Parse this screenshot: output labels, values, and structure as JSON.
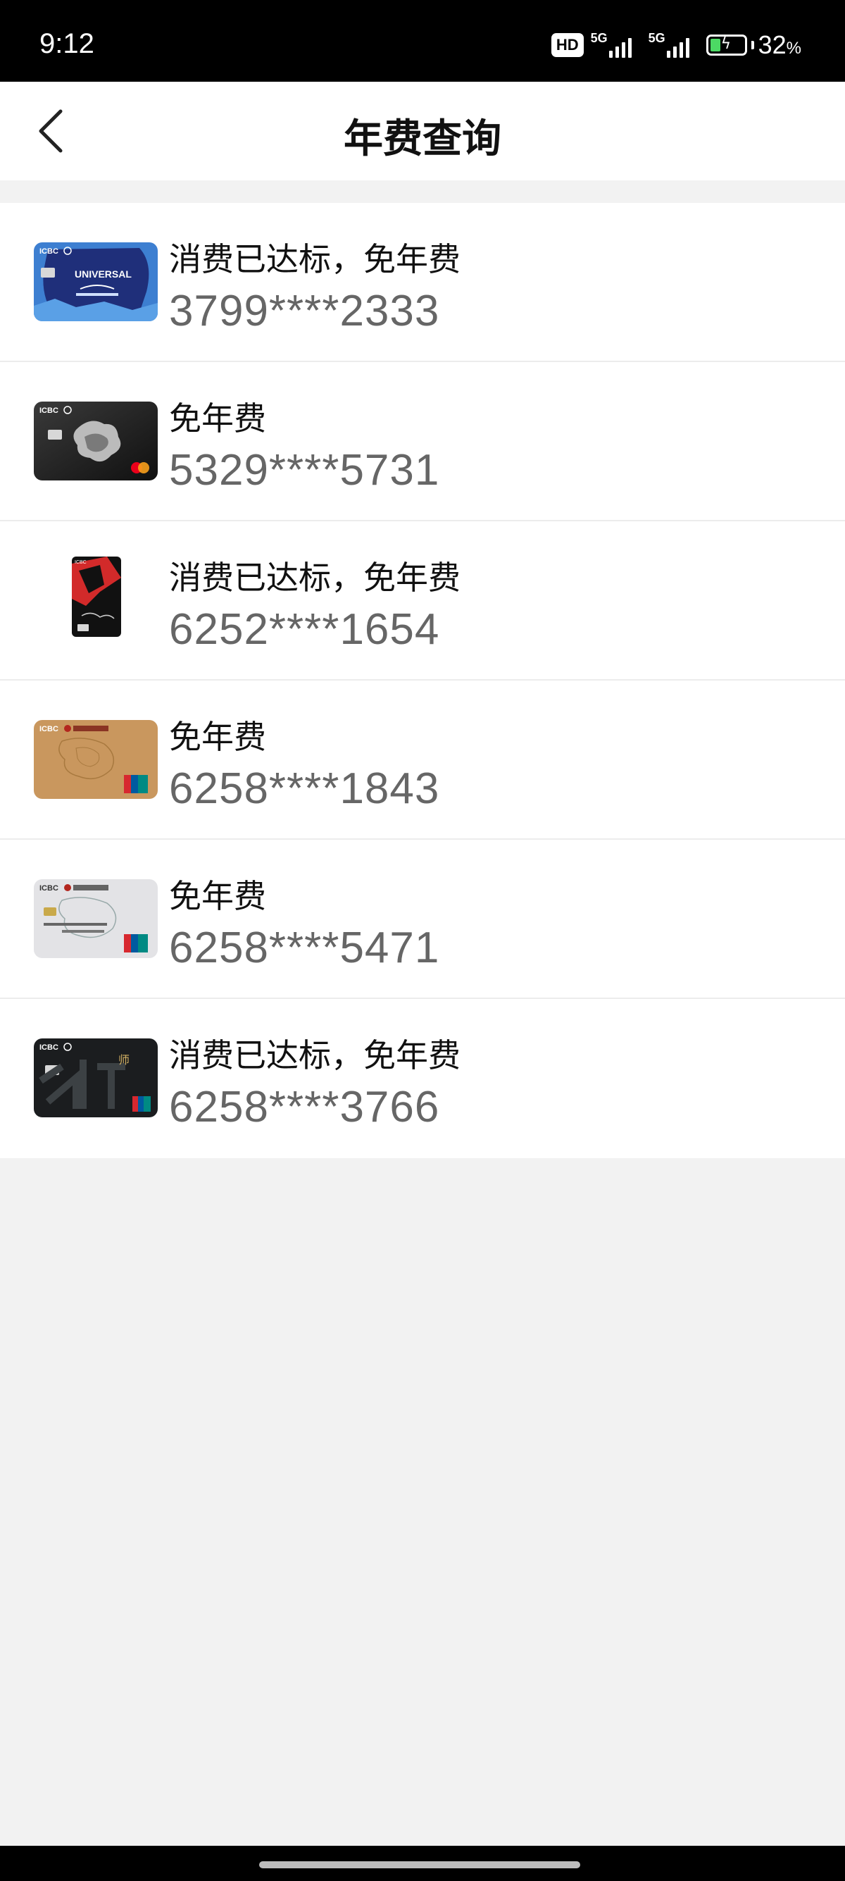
{
  "status_bar": {
    "time": "9:12",
    "hd_badge": "HD",
    "signal_1_label": "5G",
    "signal_2_label": "5G",
    "battery_percent": "32",
    "battery_unit": "%",
    "battery_level": 0.32
  },
  "header": {
    "title": "年费查询",
    "back_icon": "chevron-left-icon"
  },
  "cards": [
    {
      "status": "消费已达标，免年费",
      "number": "3799****2333",
      "thumb_style": "universal-blue"
    },
    {
      "status": "免年费",
      "number": "5329****5731",
      "thumb_style": "black-mastercard"
    },
    {
      "status": "消费已达标，免年费",
      "number": "6252****1654",
      "thumb_style": "vertical-red-black"
    },
    {
      "status": "免年费",
      "number": "6258****1843",
      "thumb_style": "gold-unionpay"
    },
    {
      "status": "免年费",
      "number": "6258****5471",
      "thumb_style": "silver-unionpay"
    },
    {
      "status": "消费已达标，免年费",
      "number": "6258****3766",
      "thumb_style": "dark-unionpay"
    }
  ],
  "colors": {
    "background": "#f2f2f2",
    "status_text": "#111111",
    "number_text": "#666666",
    "battery_green": "#4cd964"
  }
}
